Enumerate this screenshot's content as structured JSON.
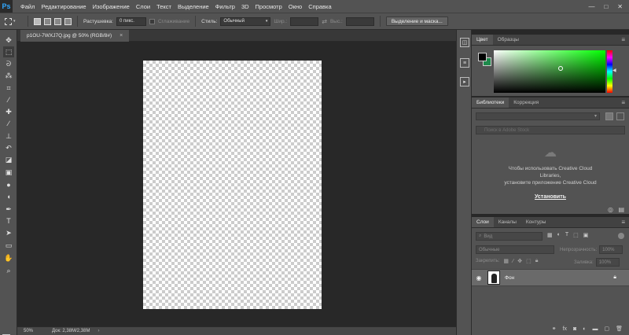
{
  "app": {
    "logo": "Ps"
  },
  "menu": [
    "Файл",
    "Редактирование",
    "Изображение",
    "Слои",
    "Текст",
    "Выделение",
    "Фильтр",
    "3D",
    "Просмотр",
    "Окно",
    "Справка"
  ],
  "window_controls": {
    "minimize": "—",
    "maximize": "□",
    "close": "✕"
  },
  "options": {
    "feather_label": "Растушевка:",
    "feather_value": "0 пикс.",
    "antialias_label": "Сглаживание",
    "style_label": "Стиль:",
    "style_value": "Обычный",
    "width_label": "Шир.:",
    "height_label": "Выс.:",
    "refine_button": "Выделение и маска..."
  },
  "tools": [
    {
      "name": "move-tool",
      "glyph": "✥"
    },
    {
      "name": "marquee-tool",
      "glyph": "⬚"
    },
    {
      "name": "lasso-tool",
      "glyph": "ᘐ"
    },
    {
      "name": "magic-wand-tool",
      "glyph": "⁂"
    },
    {
      "name": "crop-tool",
      "glyph": "⌗"
    },
    {
      "name": "eyedropper-tool",
      "glyph": "⁄"
    },
    {
      "name": "healing-brush-tool",
      "glyph": "✚"
    },
    {
      "name": "brush-tool",
      "glyph": "∕"
    },
    {
      "name": "clone-stamp-tool",
      "glyph": "⊥"
    },
    {
      "name": "history-brush-tool",
      "glyph": "↶"
    },
    {
      "name": "eraser-tool",
      "glyph": "◪"
    },
    {
      "name": "gradient-tool",
      "glyph": "▣"
    },
    {
      "name": "blur-tool",
      "glyph": "●"
    },
    {
      "name": "dodge-tool",
      "glyph": "◖"
    },
    {
      "name": "pen-tool",
      "glyph": "✒"
    },
    {
      "name": "type-tool",
      "glyph": "T"
    },
    {
      "name": "path-selection-tool",
      "glyph": "➤"
    },
    {
      "name": "rectangle-tool",
      "glyph": "▭"
    },
    {
      "name": "hand-tool",
      "glyph": "✋"
    },
    {
      "name": "zoom-tool",
      "glyph": "⌕"
    }
  ],
  "document": {
    "tab_title": "p1OU-7WXJ7Q.jpg @ 50% (RGB/8#)",
    "tab_close": "×"
  },
  "status": {
    "zoom": "50%",
    "doc_info": "Док: 2,38M/2,38M",
    "arrow": "›"
  },
  "color_panel": {
    "tabs": [
      "Цвет",
      "Образцы"
    ],
    "fg_color": "#000000",
    "bg_color": "#1f8a4c",
    "hue": "#00ff00"
  },
  "libraries_panel": {
    "tabs": [
      "Библиотеки",
      "Коррекция"
    ],
    "search_placeholder": "Поиск в Adobe Stock",
    "message_lines": [
      "Чтобы использовать Creative Cloud",
      "Libraries,",
      "установите приложение Creative Cloud"
    ],
    "install_link": "Установить"
  },
  "layers_panel": {
    "tabs": [
      "Слои",
      "Каналы",
      "Контуры"
    ],
    "filter_label": "Вид",
    "blend_mode": "Обычные",
    "opacity_label": "Непрозрачность:",
    "opacity_value": "100%",
    "lock_label": "Закрепить:",
    "fill_label": "Заливка:",
    "fill_value": "100%",
    "layers": [
      {
        "name": "Фон",
        "visible": true,
        "locked": true
      }
    ]
  }
}
